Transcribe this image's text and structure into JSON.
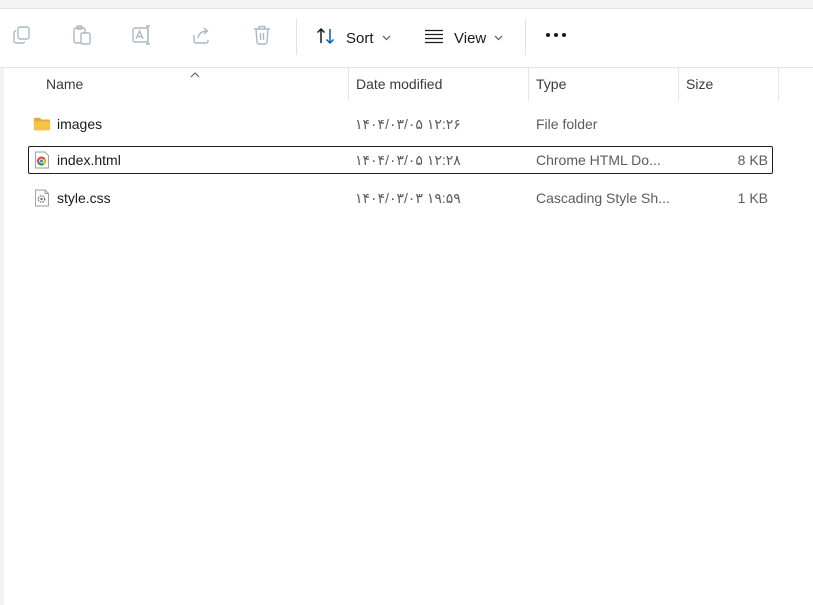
{
  "toolbar": {
    "sort_label": "Sort",
    "view_label": "View",
    "icons": {
      "copy": "copy-icon",
      "paste": "paste-icon",
      "rename": "rename-icon",
      "share": "share-icon",
      "delete": "delete-icon",
      "sort": "sort-arrows-icon",
      "view": "view-lines-icon",
      "more": "more-horizontal-icon"
    }
  },
  "columns": {
    "name": "Name",
    "date": "Date modified",
    "type": "Type",
    "size": "Size"
  },
  "files": [
    {
      "icon": "folder-icon",
      "name": "images",
      "date": "۱۴۰۴/۰۳/۰۵ ۱۲:۲۶",
      "type": "File folder",
      "size": ""
    },
    {
      "icon": "chrome-html-icon",
      "name": "index.html",
      "date": "۱۴۰۴/۰۳/۰۵ ۱۲:۲۸",
      "type": "Chrome HTML Do...",
      "size": "8 KB"
    },
    {
      "icon": "css-file-icon",
      "name": "style.css",
      "date": "۱۴۰۴/۰۳/۰۳ ۱۹:۵۹",
      "type": "Cascading Style Sh...",
      "size": "1 KB"
    }
  ],
  "colors": {
    "folder": "#f4c542",
    "focus_border": "#1f1f1f",
    "icon_disabled": "#a9b9c9",
    "accent": "#005fb8"
  }
}
